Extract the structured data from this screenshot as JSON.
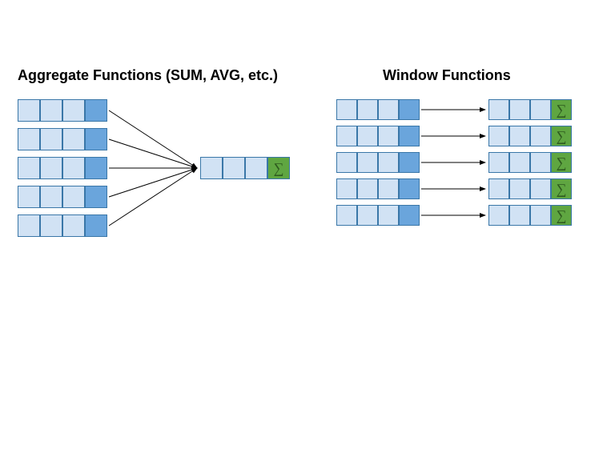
{
  "titles": {
    "aggregate": "Aggregate Functions (SUM, AVG, etc.)",
    "window": "Window Functions"
  },
  "sigma": "∑",
  "colors": {
    "light": "#d1e2f4",
    "mid": "#6aa5dc",
    "sigma_bg": "#5fa641",
    "border": "#3a77a8"
  },
  "diagram": {
    "aggregate": {
      "input_rows": 5,
      "input_cols_light": 3,
      "input_cols_mid": 1,
      "output_rows": 1,
      "output_cols_light": 3,
      "output_has_sigma": true,
      "description": "five rows collapse via arrows into one output row ending in sigma"
    },
    "window": {
      "input_rows": 5,
      "input_cols_light": 3,
      "input_cols_mid": 1,
      "output_rows": 5,
      "output_cols_light": 3,
      "output_has_sigma": true,
      "description": "each input row maps to a corresponding output row ending in sigma"
    }
  }
}
